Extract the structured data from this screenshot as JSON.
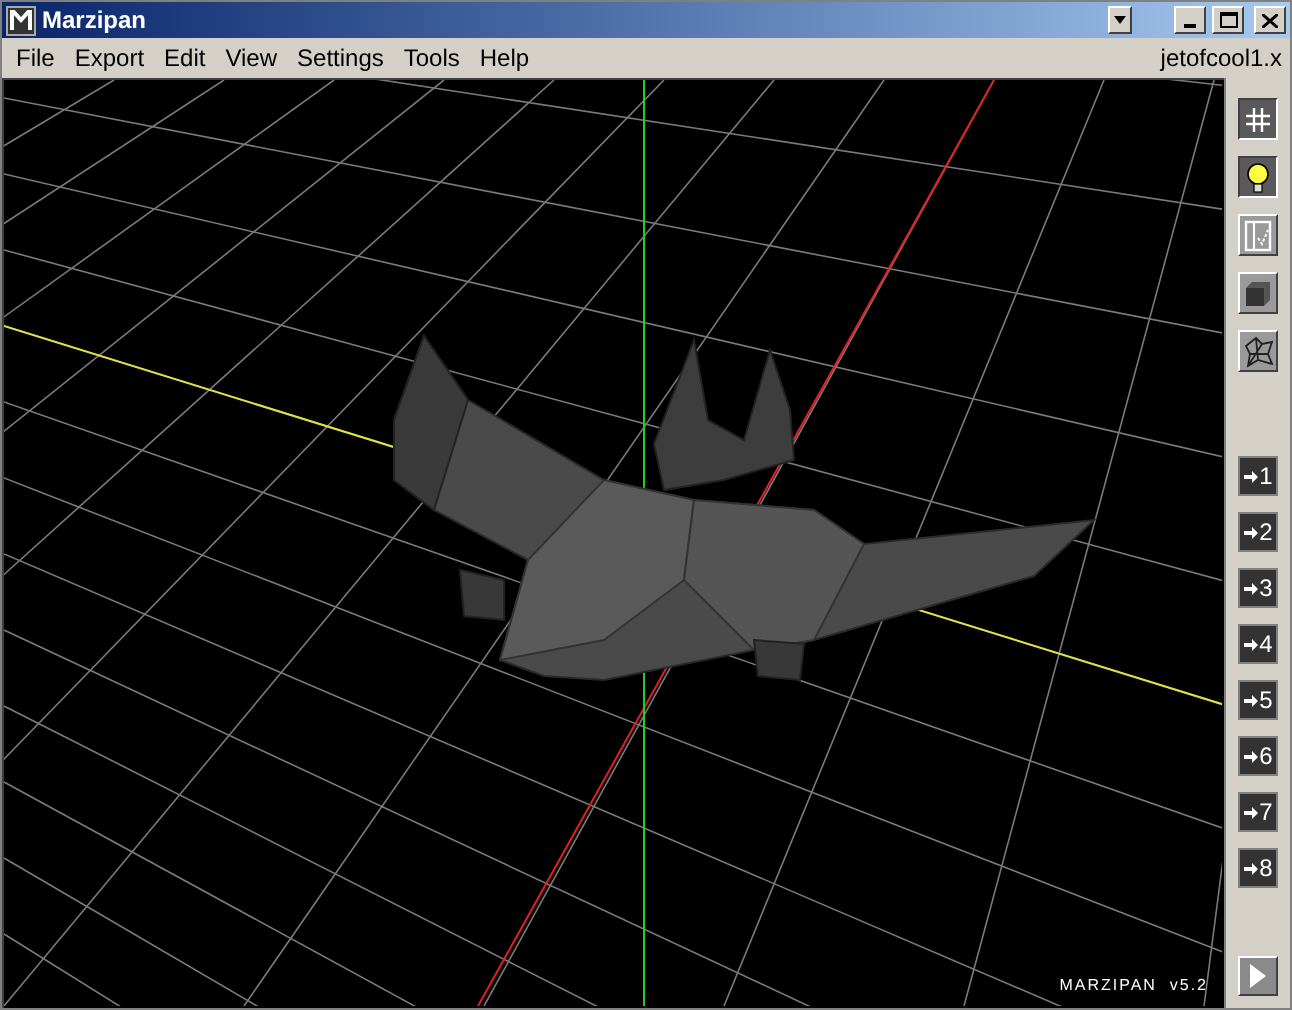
{
  "window": {
    "title": "Marzipan"
  },
  "menu": [
    "File",
    "Export",
    "Edit",
    "View",
    "Settings",
    "Tools",
    "Help"
  ],
  "file_name": "jetofcool1.x",
  "toolbar": [
    {
      "kind": "grid",
      "on": true
    },
    {
      "kind": "light",
      "on": true
    },
    {
      "kind": "select",
      "on": false
    },
    {
      "kind": "cube",
      "on": false
    },
    {
      "kind": "mesh",
      "on": false
    }
  ],
  "camera_buttons": [
    "1",
    "2",
    "3",
    "4",
    "5",
    "6",
    "7",
    "8"
  ],
  "version_label": "MARZIPAN  v5.2"
}
